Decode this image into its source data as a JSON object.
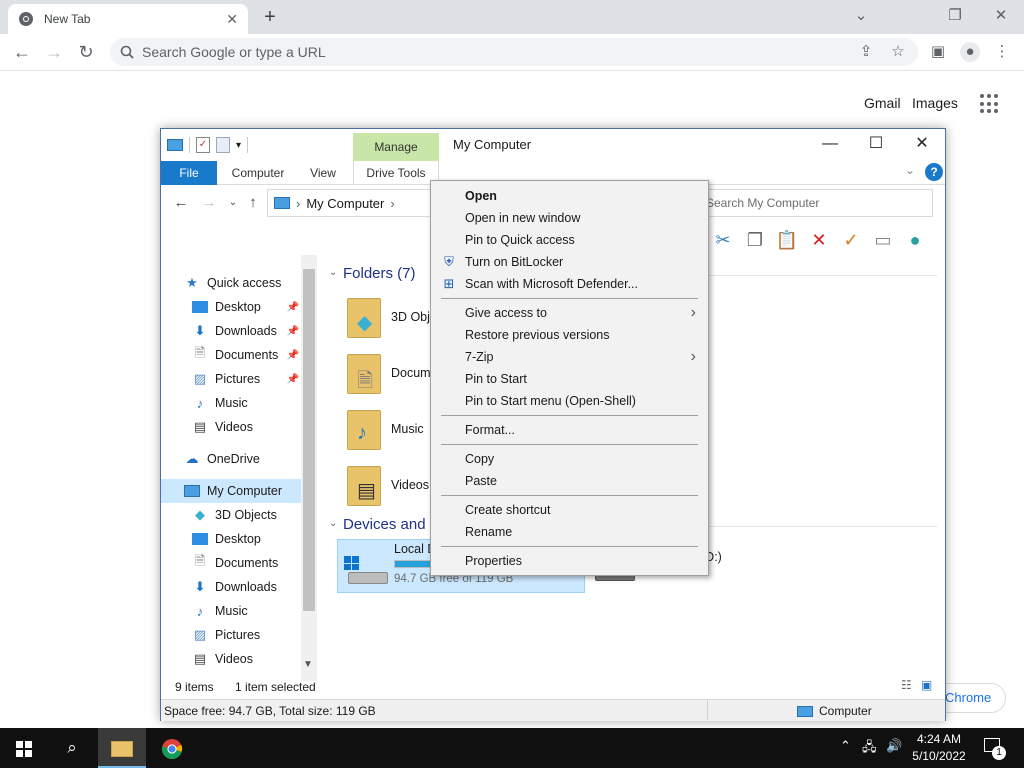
{
  "chrome": {
    "tab_title": "New Tab",
    "tab_close": "✕",
    "new_tab": "+",
    "omnibox_placeholder": "Search Google or type a URL",
    "ntp_links": {
      "gmail": "Gmail",
      "images": "Images"
    },
    "customize": "Chrome"
  },
  "explorer": {
    "ribbon": {
      "manage": "Manage",
      "drive_tools": "Drive Tools",
      "tabs": [
        "File",
        "Computer",
        "View"
      ]
    },
    "window_title": "My Computer",
    "address": "My Computer",
    "search_placeholder": "Search My Computer",
    "nav": {
      "quick_access": "Quick access",
      "qa_items": [
        "Desktop",
        "Downloads",
        "Documents",
        "Pictures",
        "Music",
        "Videos"
      ],
      "onedrive": "OneDrive",
      "my_computer": "My Computer",
      "pc_items": [
        "3D Objects",
        "Desktop",
        "Documents",
        "Downloads",
        "Music",
        "Pictures",
        "Videos"
      ]
    },
    "groups": {
      "folders": "Folders (7)",
      "devices": "Devices and drives (2)"
    },
    "folders": [
      "3D Objects",
      "Documents",
      "Music",
      "Videos"
    ],
    "drive": {
      "name": "Local Disk (C:)",
      "free": "94.7 GB free of 119 GB",
      "used_fraction": 0.2
    },
    "second_drive_label": "(D:)",
    "status": {
      "items": "9 items",
      "selected": "1 item selected",
      "space": "Space free: 94.7 GB, Total size: 119 GB",
      "location": "Computer"
    }
  },
  "context_menu": {
    "open": "Open",
    "open_new_window": "Open in new window",
    "pin_quick_access": "Pin to Quick access",
    "bitlocker": "Turn on BitLocker",
    "defender": "Scan with Microsoft Defender...",
    "give_access": "Give access to",
    "restore": "Restore previous versions",
    "zip": "7-Zip",
    "pin_start": "Pin to Start",
    "pin_start_shell": "Pin to Start menu (Open-Shell)",
    "format": "Format...",
    "copy": "Copy",
    "paste": "Paste",
    "create_shortcut": "Create shortcut",
    "rename": "Rename",
    "properties": "Properties"
  },
  "taskbar": {
    "time": "4:24 AM",
    "date": "5/10/2022",
    "notifications": "1"
  },
  "colors": {
    "accent_blue": "#1979ca",
    "manage_green": "#c8e6a8",
    "selection": "#cce8ff",
    "drive_fill": "#26a0da",
    "taskbar": "#101010"
  }
}
